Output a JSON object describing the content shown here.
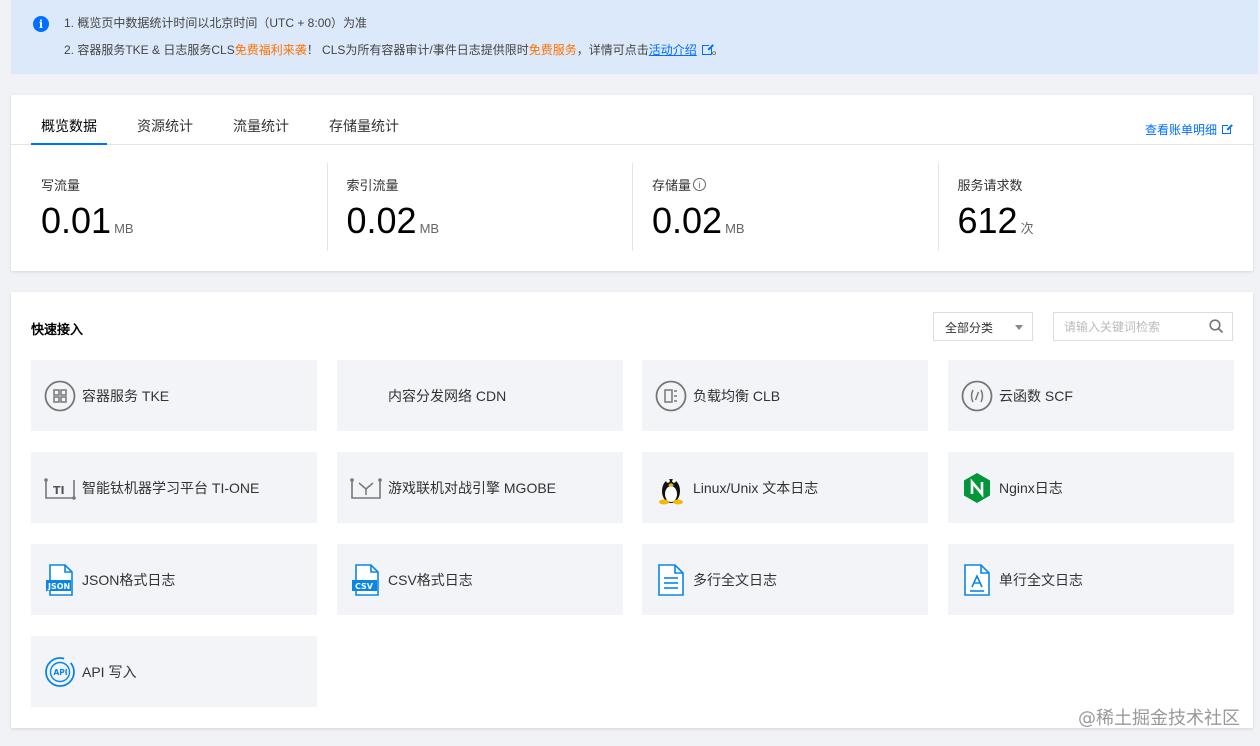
{
  "notice": {
    "line1": "1. 概览页中数据统计时间以北京时间（UTC + 8:00）为准",
    "line2_a": "2. 容器服务TKE & 日志服务CLS",
    "line2_b": "免费福利来袭",
    "line2_c": "！ CLS为所有容器审计/事件日志提供限时",
    "line2_d": "免费服务",
    "line2_e": "，详情可点击",
    "line2_link": "活动介绍",
    "line2_end": "。"
  },
  "overview": {
    "tabs": [
      "概览数据",
      "资源统计",
      "流量统计",
      "存储量统计"
    ],
    "bill_link": "查看账单明细",
    "stats": [
      {
        "label": "写流量",
        "value": "0.01",
        "unit": "MB"
      },
      {
        "label": "索引流量",
        "value": "0.02",
        "unit": "MB"
      },
      {
        "label": "存储量",
        "value": "0.02",
        "unit": "MB"
      },
      {
        "label": "服务请求数",
        "value": "612",
        "unit": "次"
      }
    ]
  },
  "quick": {
    "title": "快速接入",
    "category_select": "全部分类",
    "search_placeholder": "请输入关键词检索",
    "tiles": [
      {
        "label": "容器服务 TKE",
        "icon": "tke-icon"
      },
      {
        "label": "内容分发网络 CDN",
        "icon": "cdn-icon"
      },
      {
        "label": "负载均衡 CLB",
        "icon": "clb-icon"
      },
      {
        "label": "云函数 SCF",
        "icon": "scf-icon"
      },
      {
        "label": "智能钛机器学习平台 TI-ONE",
        "icon": "ti-one-icon"
      },
      {
        "label": "游戏联机对战引擎 MGOBE",
        "icon": "mgobe-icon"
      },
      {
        "label": "Linux/Unix 文本日志",
        "icon": "linux-icon"
      },
      {
        "label": "Nginx日志",
        "icon": "nginx-icon"
      },
      {
        "label": "JSON格式日志",
        "icon": "json-file-icon"
      },
      {
        "label": "CSV格式日志",
        "icon": "csv-file-icon"
      },
      {
        "label": "多行全文日志",
        "icon": "multiline-doc-icon"
      },
      {
        "label": "单行全文日志",
        "icon": "single-line-doc-icon"
      },
      {
        "label": "API 写入",
        "icon": "api-icon"
      }
    ]
  },
  "watermark": "@稀土掘金技术社区"
}
